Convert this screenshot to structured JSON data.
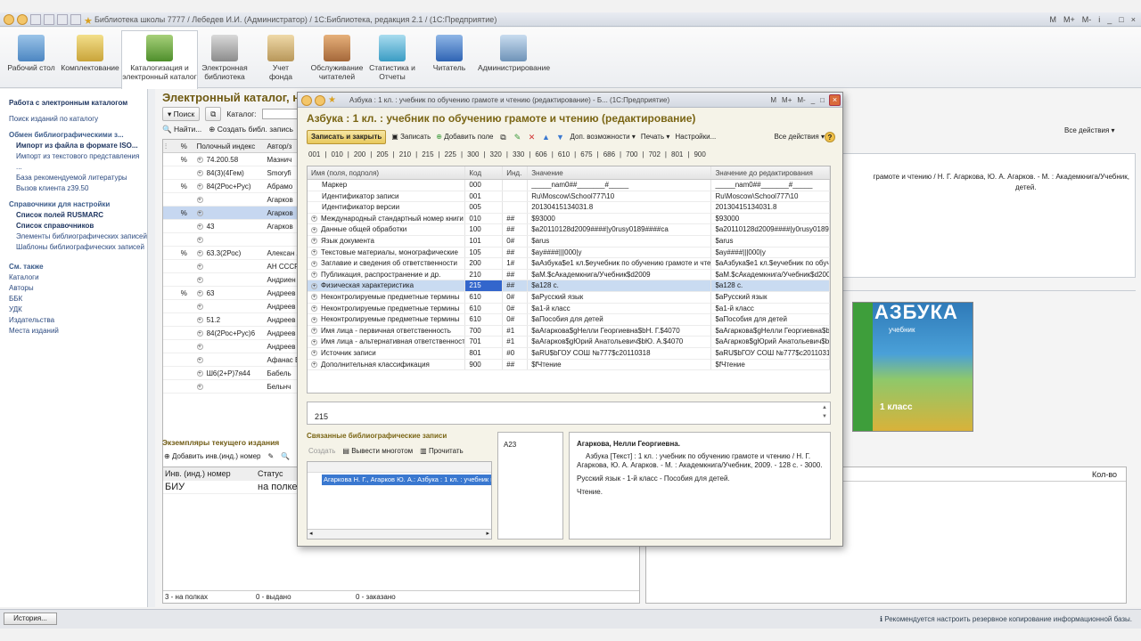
{
  "window": {
    "title": "Библиотека школы 7777 / Лебедев И.И. (Администратор) /  1С:Библиотека, редакция 2.1 /  (1С:Предприятие)",
    "controls": [
      "M",
      "M+",
      "M-",
      "i",
      "_",
      "□",
      "×"
    ]
  },
  "sections": [
    {
      "label": "Рабочий стол",
      "icon": "desk-icon"
    },
    {
      "label": "Комплектование",
      "icon": "acquisition-icon"
    },
    {
      "label": "Каталогизация и электронный каталог",
      "icon": "catalog-icon"
    },
    {
      "label": "Электронная библиотека",
      "icon": "e-library-icon"
    },
    {
      "label": "Учет фонда",
      "icon": "fund-icon"
    },
    {
      "label": "Обслуживание читателей",
      "icon": "service-icon"
    },
    {
      "label": "Статистика и Отчеты",
      "icon": "stats-icon"
    },
    {
      "label": "Читатель",
      "icon": "reader-icon"
    },
    {
      "label": "Администрирование",
      "icon": "admin-icon"
    }
  ],
  "left_panel": {
    "heading": "Работа с электронным каталогом",
    "search_link": "Поиск изданий по каталогу",
    "exchange_heading": "Обмен библиографическими з...",
    "exchange_items": [
      "Импорт из файла в формате ISO...",
      "Импорт из текстового представления ...",
      "База рекомендуемой литературы",
      "Вызов клиента z39.50"
    ],
    "ref_heading": "Справочники для настройки",
    "ref_items": [
      "Список полей RUSMARC",
      "Список справочников",
      "Элементы библиографических записей",
      "Шаблоны библиографических записей"
    ],
    "see_also_heading": "См. также",
    "see_also_items": [
      "Каталоги",
      "Авторы",
      "ББК",
      "УДК",
      "Издательства",
      "Места изданий"
    ]
  },
  "main": {
    "title": "Электронный каталог, наз",
    "search_button": "Поиск",
    "catalog_label": "Каталог:",
    "find_button": "Найти...",
    "create_record_button": "Создать библ. запись",
    "all_actions": "Все действия",
    "table_headers": [
      "Полочный индекс",
      "Автор/з"
    ],
    "catalog_rows": [
      {
        "shelf": "74.200.58",
        "author": "Мазнич",
        "sel": false
      },
      {
        "shelf": "84(3)(4Гем)",
        "author": "Smoryfi",
        "sel": false
      },
      {
        "shelf": "84(2Рос+Рус)",
        "author": "Абрамо",
        "sel": false
      },
      {
        "shelf": "",
        "author": "Агарков",
        "sel": false
      },
      {
        "shelf": "",
        "author": "Агарков",
        "sel": true
      },
      {
        "shelf": "43",
        "author": "Агарков",
        "sel": false
      },
      {
        "shelf": "",
        "author": "",
        "sel": false
      },
      {
        "shelf": "63.3(2Рос)",
        "author": "Алексан А.",
        "sel": false
      },
      {
        "shelf": "",
        "author": "АН СССР ВИНИТ",
        "sel": false
      },
      {
        "shelf": "",
        "author": "Андриен",
        "sel": false
      },
      {
        "shelf": "63",
        "author": "Андреев",
        "sel": false
      },
      {
        "shelf": "",
        "author": "Андреев",
        "sel": false
      },
      {
        "shelf": "51.2",
        "author": "Андреев",
        "sel": false
      },
      {
        "shelf": "84(2Рос+Рус)6",
        "author": "Андреев",
        "sel": false
      },
      {
        "shelf": "",
        "author": "Андреев",
        "sel": false
      },
      {
        "shelf": "",
        "author": "Афанас В.",
        "sel": false
      },
      {
        "shelf": "Ш6(2+Р)7я44",
        "author": "Бабель",
        "sel": false
      },
      {
        "shelf": "",
        "author": "Бельнч",
        "sel": false
      }
    ],
    "right_text_line1": "грамоте и чтению / Н. Г. Агаркова, Ю. А. Агарков. - М. : Академкнига/Учебник,",
    "right_text_line2": "детей.",
    "book_cover_title": "АЗБУКА",
    "book_cover_sub": "учебник",
    "book_cover_class": "1 класс",
    "items_title": "Экземпляры текущего издания",
    "add_inv_button": "Добавить инв.(инд.) номер",
    "items_headers": [
      "Инв. (инд.) номер",
      "Статус"
    ],
    "items_rows": [
      {
        "inv": "БИУ",
        "status": "на полке"
      }
    ],
    "items_footer": [
      "3 - на полках",
      "0 - выдано",
      "0 - заказано"
    ],
    "qty_header": "Кол-во"
  },
  "dialog": {
    "title": "Азбука : 1 кл. : учебник по обучению грамоте и чтению (редактирование) - Б... (1С:Предприятие)",
    "heading": "Азбука : 1 кл. : учебник по обучению грамоте и чтению (редактирование)",
    "title_controls": [
      "M",
      "M+",
      "M-",
      "_",
      "□"
    ],
    "toolbar": {
      "save_close": "Записать и закрыть",
      "save": "Записать",
      "add_field": "Добавить поле",
      "more": "Доп. возможности",
      "print": "Печать",
      "settings": "Настройки...",
      "all_actions": "Все действия"
    },
    "code_links": [
      "001",
      "010",
      "200",
      "205",
      "210",
      "215",
      "225",
      "300",
      "320",
      "330",
      "606",
      "610",
      "675",
      "686",
      "700",
      "702",
      "801",
      "900"
    ],
    "headers": [
      "Имя (поля, подполя)",
      "Код",
      "Инд.",
      "Значение",
      "Значение до редактирования"
    ],
    "rows": [
      {
        "name": "Маркер",
        "code": "000",
        "ind": "",
        "value": "_____nam0##_______#_____",
        "prev": "_____nam0##_______#_____",
        "kind": "sub"
      },
      {
        "name": "Идентификатор записи",
        "code": "001",
        "ind": "",
        "value": "Ru\\Moscow\\School777\\10",
        "prev": "Ru\\Moscow\\School777\\10",
        "kind": "sub"
      },
      {
        "name": "Идентификатор версии",
        "code": "005",
        "ind": "",
        "value": "20130415134031.8",
        "prev": "20130415134031.8",
        "kind": "sub"
      },
      {
        "name": "Международный стандартный номер книги (...",
        "code": "010",
        "ind": "##",
        "value": "$93000",
        "prev": "$93000",
        "kind": "grp"
      },
      {
        "name": "Данные общей обработки",
        "code": "100",
        "ind": "##",
        "value": "$a20110128d2009####|y0rusy0189####ca",
        "prev": "$a20110128d2009####|y0rusy0189####ca",
        "kind": "grp"
      },
      {
        "name": "Язык документа",
        "code": "101",
        "ind": "0#",
        "value": "$arus",
        "prev": "$arus",
        "kind": "grp"
      },
      {
        "name": "Текстовые материалы, монографические",
        "code": "105",
        "ind": "##",
        "value": "$ay####|||000|y",
        "prev": "$ay####|||000|y",
        "kind": "grp"
      },
      {
        "name": "Заглавие и сведения об ответственности",
        "code": "200",
        "ind": "1#",
        "value": "$aАзбука$e1 кл.$eучебник по обучению грамоте и чтени...",
        "prev": "$aАзбука$e1 кл.$eучебник по обуч...",
        "kind": "grp"
      },
      {
        "name": "Публикация, распространение и др.",
        "code": "210",
        "ind": "##",
        "value": "$aМ.$cАкадемкнига/Учебник$d2009",
        "prev": "$aМ.$cАкадемкнига/Учебник$d2009",
        "kind": "grp"
      },
      {
        "name": "Физическая характеристика",
        "code": "215",
        "ind": "##",
        "value": "$a128 с.",
        "prev": "$a128 с.",
        "kind": "grp",
        "sel": true
      },
      {
        "name": "Неконтролируемые предметные термины",
        "code": "610",
        "ind": "0#",
        "value": "$aРусский язык",
        "prev": "$aРусский язык",
        "kind": "grp"
      },
      {
        "name": "Неконтролируемые предметные термины",
        "code": "610",
        "ind": "0#",
        "value": "$a1-й класс",
        "prev": "$a1-й класс",
        "kind": "grp"
      },
      {
        "name": "Неконтролируемые предметные термины",
        "code": "610",
        "ind": "0#",
        "value": "$aПособия для детей",
        "prev": "$aПособия для детей",
        "kind": "grp"
      },
      {
        "name": "Имя лица - первичная ответственность",
        "code": "700",
        "ind": "#1",
        "value": "$aАгаркова$gНелли Георгиевна$bН. Г.$4070",
        "prev": "$aАгаркова$gНелли Георгиевна$b...",
        "kind": "grp"
      },
      {
        "name": "Имя лица - альтернативная ответственность",
        "code": "701",
        "ind": "#1",
        "value": "$aАгарков$gЮрий Анатольевич$bЮ. А.$4070",
        "prev": "$aАгарков$gЮрий Анатольевич$b...",
        "kind": "grp"
      },
      {
        "name": "Источник записи",
        "code": "801",
        "ind": "#0",
        "value": "$aRU$bГОУ СОШ  №777$c20110318",
        "prev": "$aRU$bГОУ СОШ  №777$c20110318",
        "kind": "grp"
      },
      {
        "name": "Дополнительная классификация",
        "code": "900",
        "ind": "##",
        "value": "$fЧтение",
        "prev": "$fЧтение",
        "kind": "grp"
      }
    ],
    "current_value": "215",
    "related_title": "Связанные библиографические записи",
    "related_toolbar": {
      "create": "Создать",
      "output_many": "Вывести многотом",
      "read": "Прочитать"
    },
    "related_selected": "Агаркова Н. Г., Агарков Ю. А.: Азбука : 1 кл. : учебник п",
    "mid_value": "A23",
    "card_author": "Агаркова, Нелли Георгиевна.",
    "card_text": "Азбука [Текст] : 1 кл. : учебник по обучению грамоте и чтению / Н. Г. Агаркова, Ю. А. Агарков. - М. : Академкнига/Учебник, 2009. - 128 с. - 3000.",
    "card_subjects": "Русский язык - 1-й класс - Пособия для детей.",
    "card_class": "Чтение."
  },
  "statusbar": {
    "history_button": "История...",
    "message": "Рекомендуется настроить резервное копирование информационной базы."
  },
  "colors": {
    "heading": "#7a6514",
    "selection": "#c9dbf1",
    "link": "#2d4b80"
  }
}
